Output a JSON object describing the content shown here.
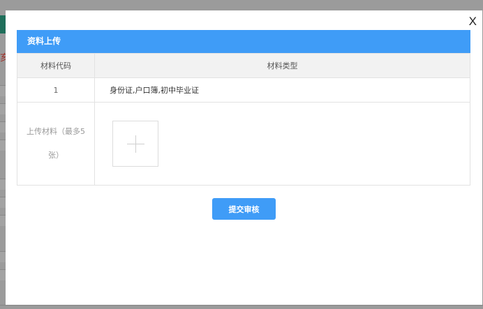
{
  "background": {
    "partial_text": "亥"
  },
  "modal": {
    "close_label": "X",
    "panel_title": "资料上传",
    "table": {
      "headers": [
        "材料代码",
        "材料类型"
      ],
      "rows": [
        {
          "code": "1",
          "types": "身份证,户口簿,初中毕业证"
        }
      ],
      "upload_label": "上传材料（最多5张）"
    },
    "submit_label": "提交审核"
  },
  "colors": {
    "accent": "#3f9cf7",
    "overlay": "#9b9b9b"
  },
  "icons": {
    "add": "plus-icon",
    "close": "close-icon"
  }
}
